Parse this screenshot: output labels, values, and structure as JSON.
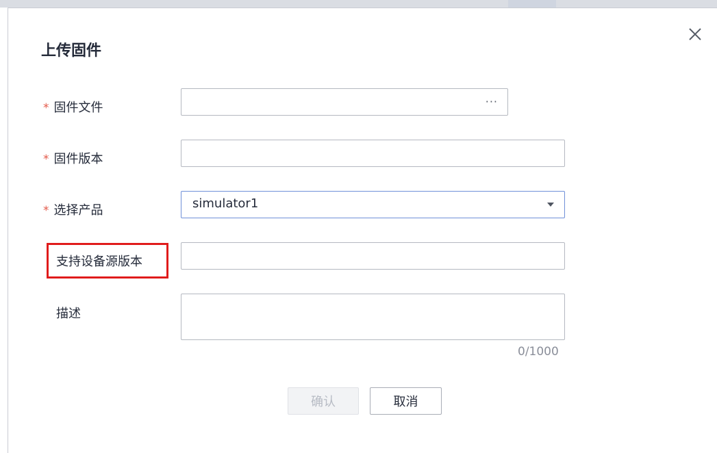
{
  "dialog": {
    "title": "上传固件",
    "close_icon": "close-icon"
  },
  "form": {
    "required_mark": "*",
    "firmware_file": {
      "label": "固件文件",
      "value": "",
      "browse_text": "···"
    },
    "firmware_version": {
      "label": "固件版本",
      "value": ""
    },
    "product": {
      "label": "选择产品",
      "selected": "simulator1",
      "caret_icon": "caret-down-icon"
    },
    "source_versions": {
      "label": "支持设备源版本",
      "value": ""
    },
    "description": {
      "label": "描述",
      "value": "",
      "counter": "0/1000"
    }
  },
  "buttons": {
    "confirm": "确认",
    "cancel": "取消"
  },
  "colors": {
    "required": "#e35a4a",
    "highlight": "#e01b1b",
    "select_border": "#6e8fd8"
  }
}
